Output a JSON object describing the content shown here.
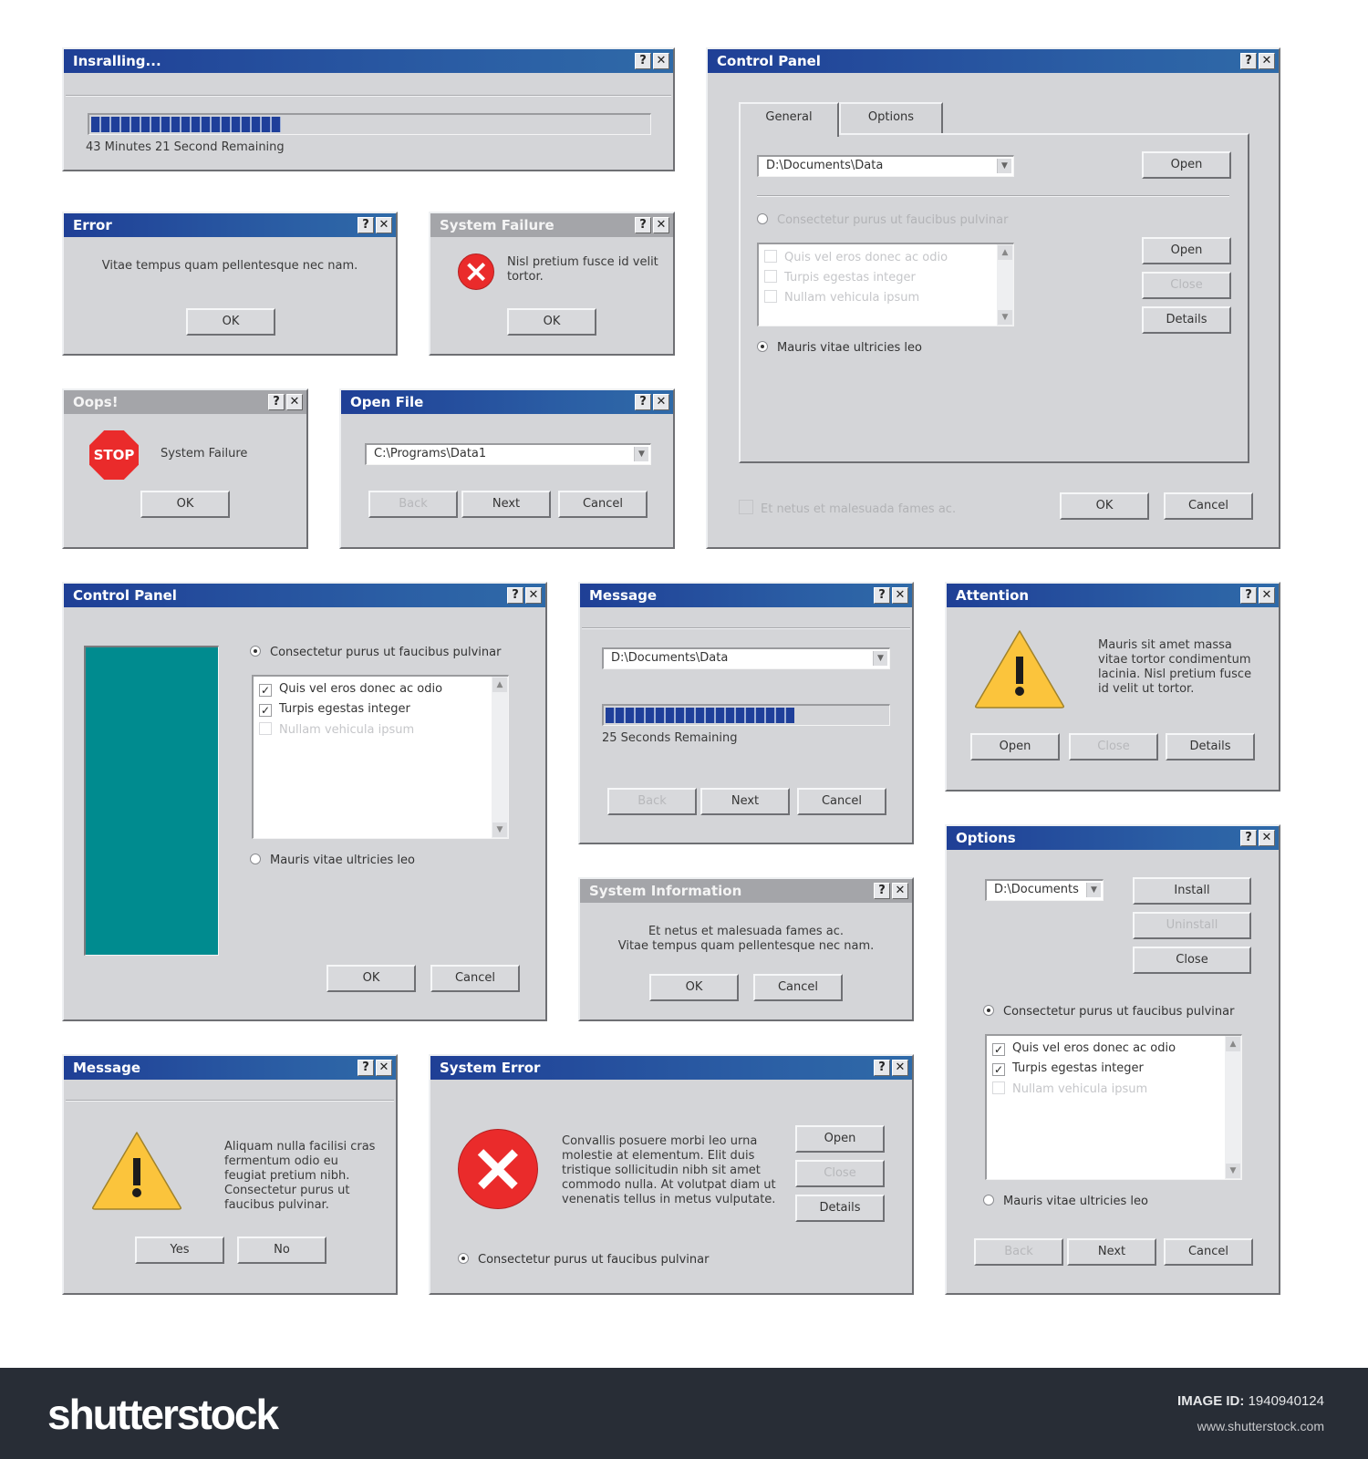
{
  "dialogs": {
    "installing": {
      "title": "Insralling...",
      "progress_fraction": 0.34,
      "status": "43 Minutes 21 Second Remaining"
    },
    "error": {
      "title": "Error",
      "message": "Vitae tempus quam pellentesque nec nam.",
      "ok": "OK"
    },
    "system_failure": {
      "title": "System Failure",
      "message": "Nisl pretium fusce id velit tortor.",
      "ok": "OK"
    },
    "oops": {
      "title": "Oops!",
      "stop_label": "STOP",
      "message": "System Failure",
      "ok": "OK"
    },
    "open_file": {
      "title": "Open File",
      "path": "C:\\Programs\\Data1",
      "back": "Back",
      "next": "Next",
      "cancel": "Cancel"
    },
    "control_panel_tabs": {
      "title": "Control Panel",
      "tabs": [
        "General",
        "Options"
      ],
      "active_tab": "General",
      "path": "D:\\Documents\\Data",
      "open_top": "Open",
      "radio1": "Consectetur purus ut faucibus pulvinar",
      "radio2": "Mauris vitae ultricies leo",
      "list": [
        {
          "label": "Quis vel eros donec ac odio",
          "checked": false
        },
        {
          "label": "Turpis egestas integer",
          "checked": false
        },
        {
          "label": "Nullam vehicula ipsum",
          "checked": false
        }
      ],
      "open": "Open",
      "close": "Close",
      "details": "Details",
      "footer_check": "Et netus et malesuada fames ac.",
      "ok": "OK",
      "cancel": "Cancel"
    },
    "control_panel_teal": {
      "title": "Control Panel",
      "accent_color": "#008b8f",
      "radio1": "Consectetur purus ut faucibus pulvinar",
      "radio2": "Mauris vitae ultricies leo",
      "list": [
        {
          "label": "Quis vel eros donec ac odio",
          "checked": true
        },
        {
          "label": "Turpis egestas integer",
          "checked": true
        },
        {
          "label": "Nullam vehicula ipsum",
          "checked": false
        }
      ],
      "ok": "OK",
      "cancel": "Cancel"
    },
    "message_progress": {
      "title": "Message",
      "path": "D:\\Documents\\Data",
      "progress_fraction": 0.67,
      "status": "25 Seconds Remaining",
      "back": "Back",
      "next": "Next",
      "cancel": "Cancel"
    },
    "system_information": {
      "title": "System Information",
      "line1": "Et netus et malesuada fames ac.",
      "line2": "Vitae tempus quam pellentesque nec nam.",
      "ok": "OK",
      "cancel": "Cancel"
    },
    "attention": {
      "title": "Attention",
      "message": "Mauris sit amet massa vitae tortor condimentum lacinia. Nisl pretium fusce id velit ut tortor.",
      "open": "Open",
      "close": "Close",
      "details": "Details"
    },
    "options": {
      "title": "Options",
      "path": "D:\\Documents",
      "install": "Install",
      "uninstall": "Uninstall",
      "close": "Close",
      "radio1": "Consectetur purus ut faucibus pulvinar",
      "radio2": "Mauris vitae ultricies leo",
      "list": [
        {
          "label": "Quis vel eros donec ac odio",
          "checked": true
        },
        {
          "label": "Turpis egestas integer",
          "checked": true
        },
        {
          "label": "Nullam vehicula ipsum",
          "checked": false
        }
      ],
      "back": "Back",
      "next": "Next",
      "cancel": "Cancel"
    },
    "message_warn": {
      "title": "Message",
      "message": "Aliquam nulla facilisi cras fermentum odio eu feugiat pretium nibh. Consectetur purus ut faucibus pulvinar.",
      "yes": "Yes",
      "no": "No"
    },
    "system_error": {
      "title": "System Error",
      "message": "Convallis posuere morbi leo urna molestie at elementum. Elit duis tristique sollicitudin nibh sit amet commodo nulla. At volutpat diam ut venenatis tellus in metus vulputate.",
      "open": "Open",
      "close": "Close",
      "details": "Details",
      "radio": "Consectetur purus ut faucibus pulvinar"
    }
  },
  "titlebar_buttons": {
    "help": "?",
    "close": "✕"
  },
  "colors": {
    "titlebar_active": "#1f3f96",
    "titlebar_inactive": "#a4a5a9",
    "window_bg": "#d4d5d8",
    "progress": "#1f3f9a",
    "error_red": "#ea2b2b",
    "warning_yellow": "#fbc43c"
  },
  "footer": {
    "brand": "shutterstock",
    "image_id_label": "IMAGE ID:",
    "image_id": "1940940124",
    "site": "www.shutterstock.com"
  }
}
